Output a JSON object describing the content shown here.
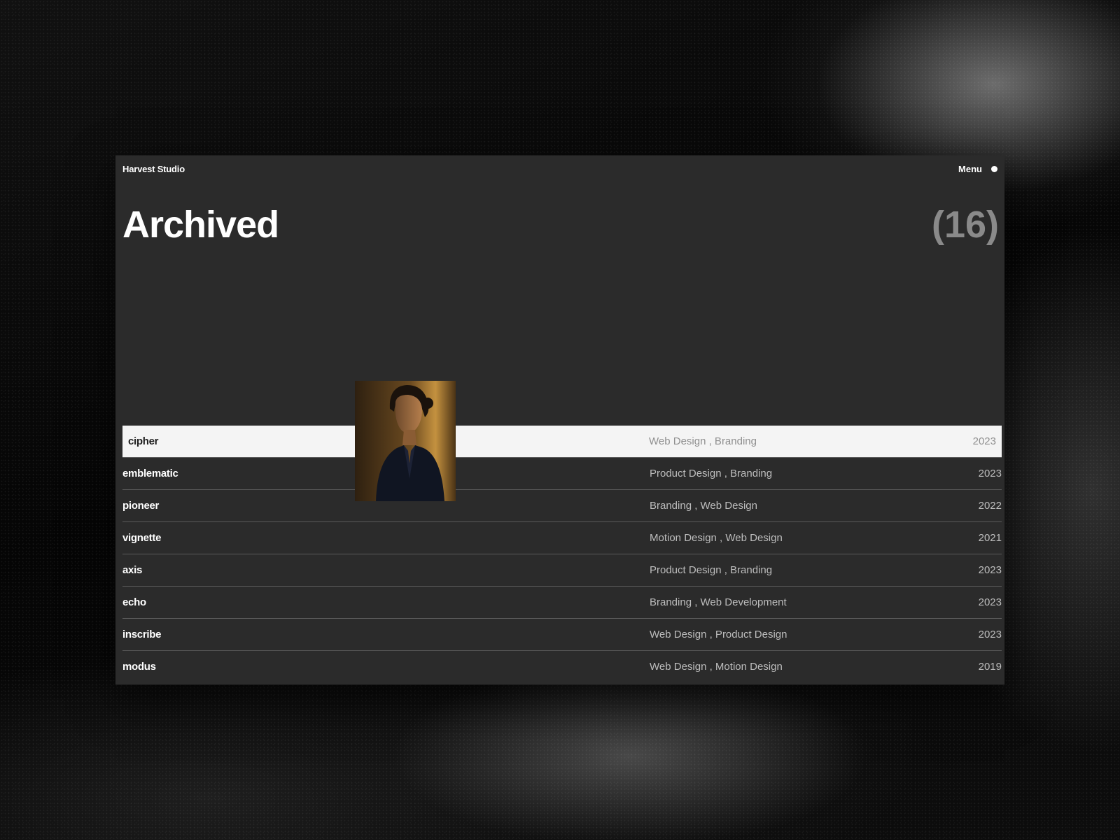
{
  "header": {
    "brand": "Harvest Studio",
    "menu_label": "Menu"
  },
  "page": {
    "title": "Archived",
    "count": "(16)"
  },
  "projects": [
    {
      "name": "cipher",
      "tags": "Web Design , Branding",
      "year": "2023",
      "active": true
    },
    {
      "name": "emblematic",
      "tags": "Product Design , Branding",
      "year": "2023"
    },
    {
      "name": "pioneer",
      "tags": "Branding , Web Design",
      "year": "2022"
    },
    {
      "name": "vignette",
      "tags": "Motion Design , Web Design",
      "year": "2021"
    },
    {
      "name": "axis",
      "tags": "Product Design , Branding",
      "year": "2023"
    },
    {
      "name": "echo",
      "tags": "Branding , Web Development",
      "year": "2023"
    },
    {
      "name": "inscribe",
      "tags": "Web Design , Product Design",
      "year": "2023"
    },
    {
      "name": "modus",
      "tags": "Web Design , Motion Design",
      "year": "2019"
    }
  ],
  "preview": {
    "icon": "portrait-photo"
  },
  "colors": {
    "panel": "#2b2b2b",
    "active_row": "#f4f4f4",
    "count_text": "#8a8a8a"
  }
}
